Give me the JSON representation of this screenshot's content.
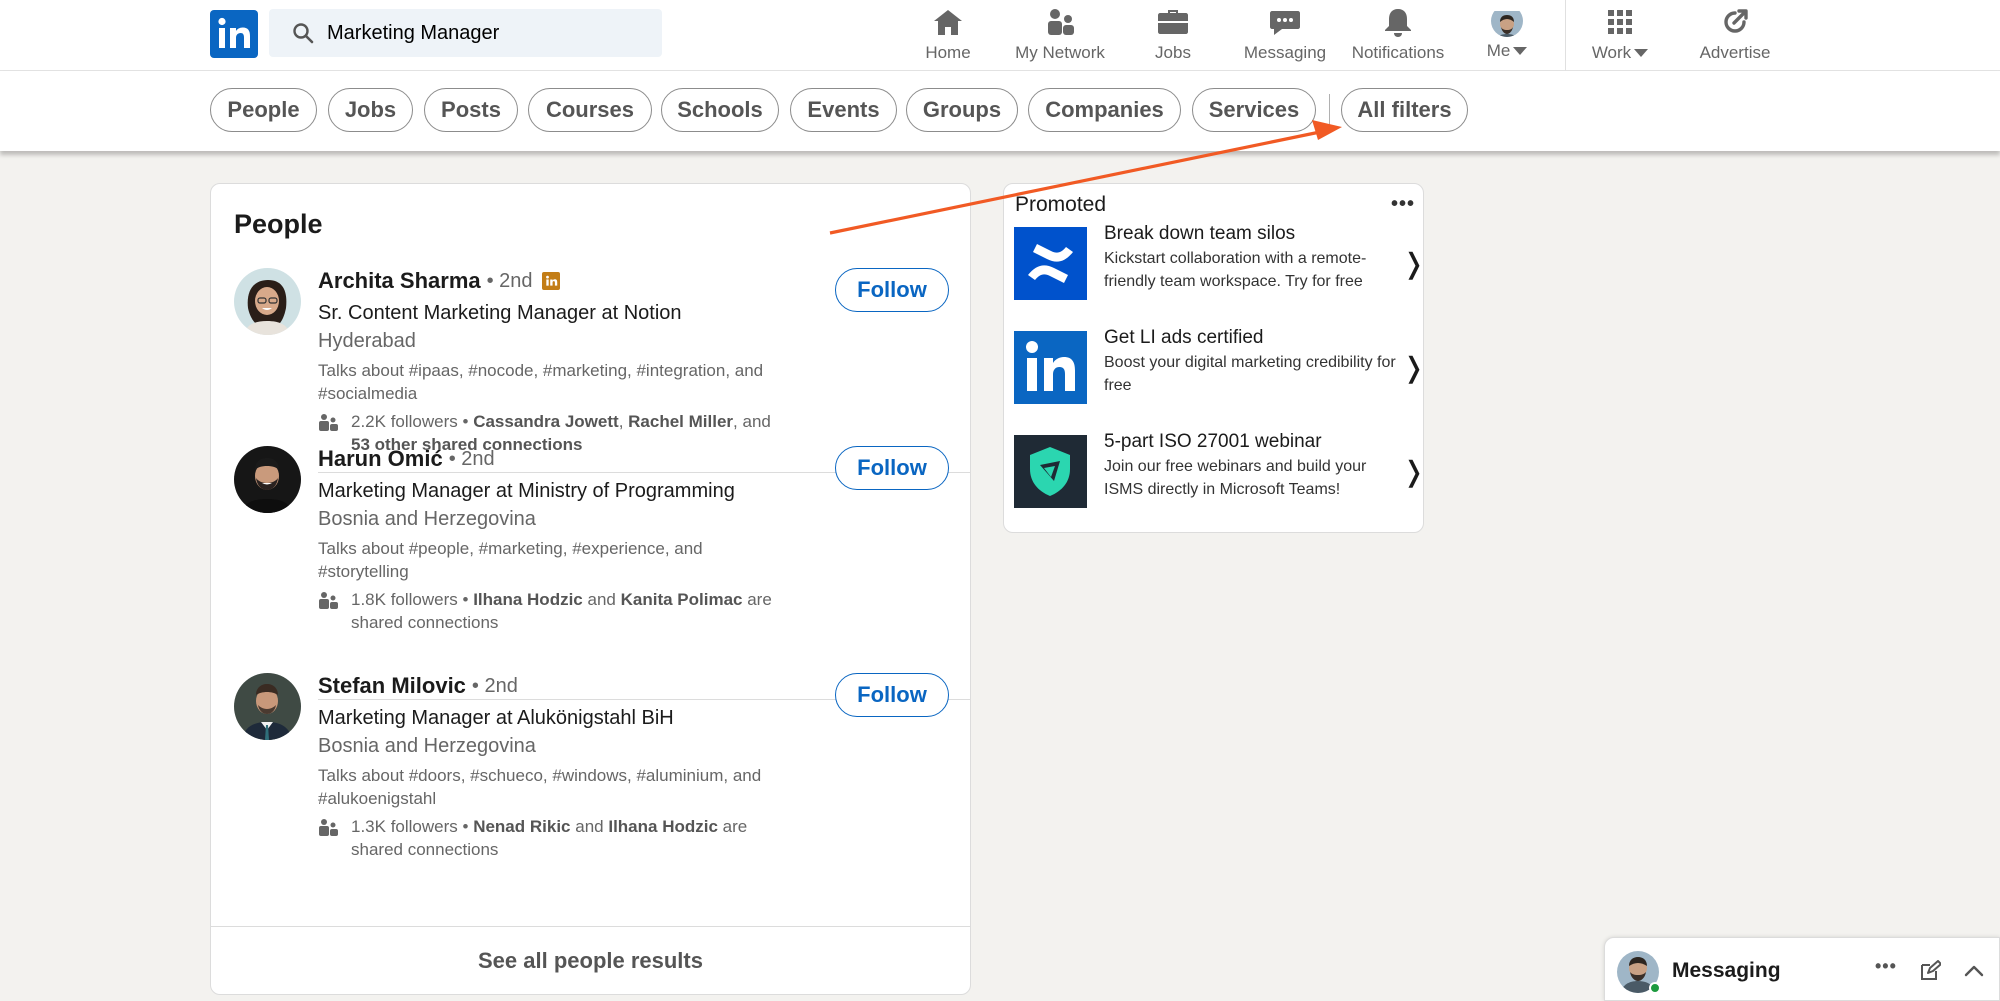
{
  "search": {
    "value": "Marketing Manager"
  },
  "nav": [
    {
      "id": "home",
      "label": "Home"
    },
    {
      "id": "network",
      "label": "My Network"
    },
    {
      "id": "jobs",
      "label": "Jobs"
    },
    {
      "id": "messaging",
      "label": "Messaging"
    },
    {
      "id": "notifications",
      "label": "Notifications"
    },
    {
      "id": "me",
      "label": "Me"
    },
    {
      "id": "work",
      "label": "Work"
    },
    {
      "id": "advertise",
      "label": "Advertise"
    }
  ],
  "filters": [
    "People",
    "Jobs",
    "Posts",
    "Courses",
    "Schools",
    "Events",
    "Groups",
    "Companies",
    "Services",
    "All filters"
  ],
  "people_card": {
    "title": "People",
    "see_all": "See all people results",
    "follow_label": "Follow",
    "people": [
      {
        "name": "Archita Sharma",
        "degree": "• 2nd",
        "headline": "Sr. Content Marketing Manager at Notion",
        "location": "Hyderabad",
        "talks": "Talks about #ipaas, #nocode, #marketing, #integration, and #socialmedia",
        "followers": "2.2K followers",
        "conn_a": "Cassandra Jowett",
        "conn_b": "Rachel Miller",
        "conn_tail_1": ",",
        "conn_tail_2": "and",
        "conn_tail_3": "53 other shared connections"
      },
      {
        "name": "Harun Omić",
        "degree": "• 2nd",
        "headline": "Marketing Manager at Ministry of Programming",
        "location": "Bosnia and Herzegovina",
        "talks": "Talks about #people, #marketing, #experience, and #storytelling",
        "followers": "1.8K followers",
        "conn_a": "Ilhana Hodzic",
        "conn_b": "Kanita Polimac",
        "conn_tail_1": "and",
        "conn_tail_2": "are shared connections"
      },
      {
        "name": "Stefan Milovic",
        "degree": "• 2nd",
        "headline": "Marketing Manager at Alukönigstahl BiH",
        "location": "Bosnia and Herzegovina",
        "talks": "Talks about #doors, #schueco, #windows, #aluminium, and #alukoenigstahl",
        "followers": "1.3K followers",
        "conn_a": "Nenad Rikic",
        "conn_b": "Ilhana Hodzic",
        "conn_tail_1": "and",
        "conn_tail_2": "are shared connections"
      }
    ]
  },
  "promoted": {
    "title": "Promoted",
    "more": "•••",
    "ads": [
      {
        "title": "Break down team silos",
        "desc": "Kickstart collaboration with a remote-friendly team workspace. Try for free",
        "chevron": "❭"
      },
      {
        "title": "Get LI ads certified",
        "desc": "Boost your digital marketing credibility for free",
        "chevron": "❭"
      },
      {
        "title": "5-part ISO 27001 webinar",
        "desc": "Join our free webinars and build your ISMS directly in Microsoft Teams!",
        "chevron": "❭"
      }
    ]
  },
  "messaging_widget": {
    "label": "Messaging",
    "more": "•••"
  },
  "colors": {
    "brand": "#0a66c2",
    "annotation_arrow": "#f15a24",
    "premium_badge": "#c37d16"
  }
}
